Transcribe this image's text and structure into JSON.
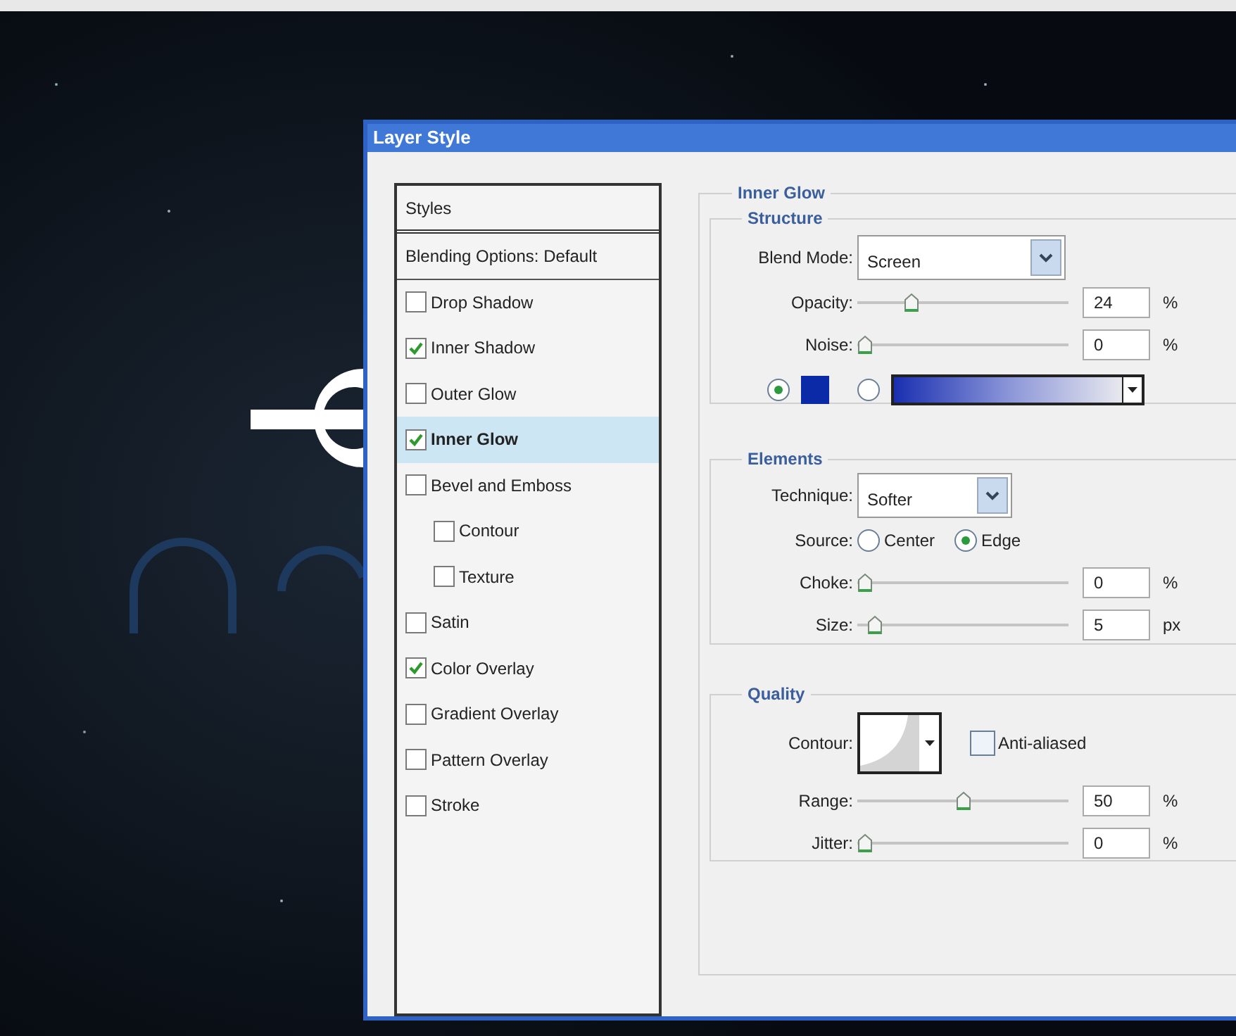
{
  "window": {
    "title": "Layer Style"
  },
  "styles_list": {
    "header": "Styles",
    "items": [
      {
        "label": "Blending Options: Default",
        "kind": "plain",
        "selected": false
      },
      {
        "label": "Drop Shadow",
        "kind": "check",
        "checked": false,
        "selected": false
      },
      {
        "label": "Inner Shadow",
        "kind": "check",
        "checked": true,
        "selected": false
      },
      {
        "label": "Outer Glow",
        "kind": "check",
        "checked": false,
        "selected": false
      },
      {
        "label": "Inner Glow",
        "kind": "check",
        "checked": true,
        "selected": true
      },
      {
        "label": "Bevel and Emboss",
        "kind": "check",
        "checked": false,
        "selected": false
      },
      {
        "label": "Contour",
        "kind": "subcheck",
        "checked": false,
        "selected": false
      },
      {
        "label": "Texture",
        "kind": "subcheck",
        "checked": false,
        "selected": false
      },
      {
        "label": "Satin",
        "kind": "check",
        "checked": false,
        "selected": false
      },
      {
        "label": "Color Overlay",
        "kind": "check",
        "checked": true,
        "selected": false
      },
      {
        "label": "Gradient Overlay",
        "kind": "check",
        "checked": false,
        "selected": false
      },
      {
        "label": "Pattern Overlay",
        "kind": "check",
        "checked": false,
        "selected": false
      },
      {
        "label": "Stroke",
        "kind": "check",
        "checked": false,
        "selected": false
      }
    ]
  },
  "inner_glow": {
    "title": "Inner Glow",
    "structure": {
      "title": "Structure",
      "blend_mode": {
        "label": "Blend Mode:",
        "value": "Screen"
      },
      "sliders": [
        {
          "label": "Opacity:",
          "level": 0.24,
          "value": "24",
          "unit": "%"
        },
        {
          "label": "Noise:",
          "level": 0,
          "value": "0",
          "unit": "%"
        }
      ],
      "fill": [
        {
          "kind": "color",
          "selected": true,
          "color": "#0a2aa8"
        },
        {
          "kind": "gradient",
          "selected": false
        }
      ]
    },
    "elements": {
      "title": "Elements",
      "technique": {
        "label": "Technique:",
        "value": "Softer"
      },
      "source": {
        "label": "Source:",
        "options": [
          {
            "label": "Center",
            "selected": false
          },
          {
            "label": "Edge",
            "selected": true
          }
        ]
      },
      "sliders": [
        {
          "label": "Choke:",
          "level": 0,
          "value": "0",
          "unit": "%"
        },
        {
          "label": "Size:",
          "level": 0.05,
          "value": "5",
          "unit": "px"
        }
      ]
    },
    "quality": {
      "title": "Quality",
      "contour": {
        "label": "Contour:"
      },
      "anti_aliased": {
        "label": "Anti-aliased",
        "checked": false
      },
      "sliders": [
        {
          "label": "Range:",
          "level": 0.5,
          "value": "50",
          "unit": "%"
        },
        {
          "label": "Jitter:",
          "level": 0,
          "value": "0",
          "unit": "%"
        }
      ]
    }
  }
}
